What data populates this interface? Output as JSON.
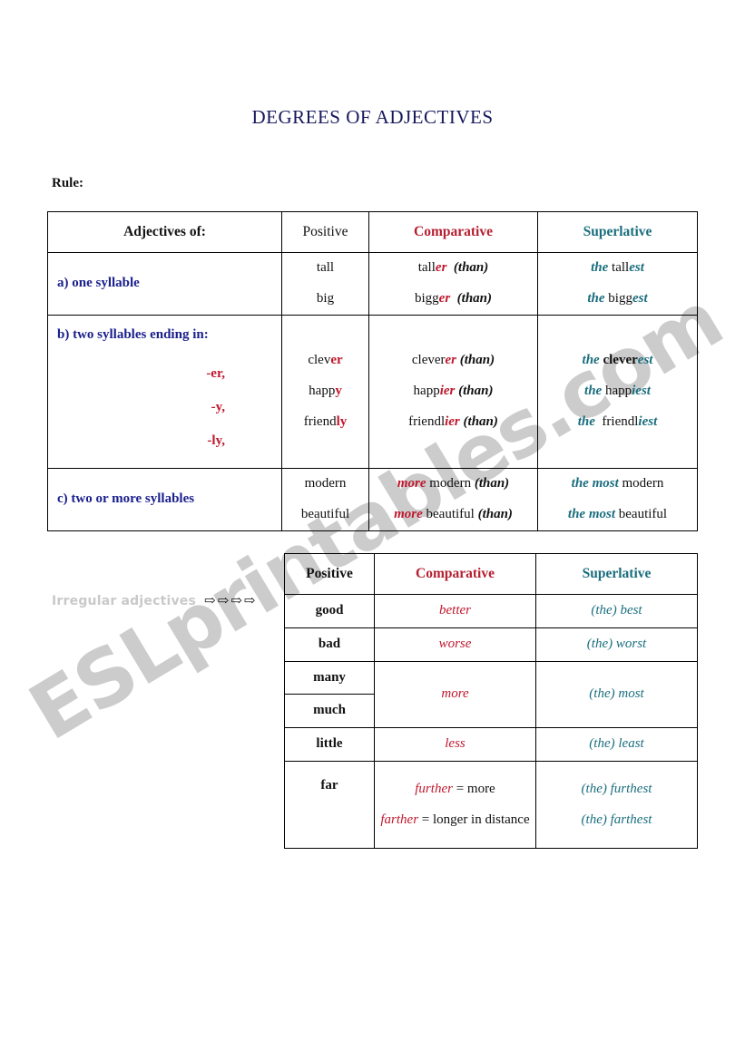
{
  "document": {
    "title": "DEGREES OF ADJECTIVES",
    "rule_label": "Rule:",
    "watermark": "ESLprintables.com"
  },
  "colors": {
    "title": "#16185c",
    "category": "#1a1f8c",
    "comparative": "#c0182e",
    "superlative": "#1a6e7e",
    "text": "#111111",
    "watermark": "#cccccc"
  },
  "rules_table": {
    "headers": {
      "category": "Adjectives of:",
      "positive": "Positive",
      "comparative": "Comparative",
      "superlative": "Superlative"
    },
    "rows": [
      {
        "category": "a) one syllable",
        "suffixes": [],
        "entries": [
          {
            "positive": "tall",
            "comparative": {
              "stem": "tall",
              "suffix": "er",
              "than": "(than)"
            },
            "superlative": {
              "the": "the",
              "stem": "tall",
              "suffix": "est"
            }
          },
          {
            "positive": "big",
            "comparative": {
              "stem": "bigg",
              "suffix": "er",
              "than": "(than)"
            },
            "superlative": {
              "the": "the",
              "stem": "bigg",
              "suffix": "est"
            }
          }
        ]
      },
      {
        "category": "b) two syllables ending in:",
        "suffixes": [
          "-er,",
          "-y,",
          "-ly,"
        ],
        "entries": [
          {
            "positive_stem": "clev",
            "positive_suffix": "er",
            "comparative": {
              "stem": "clever",
              "suffix": "er",
              "than": "(than)"
            },
            "superlative": {
              "the": "the",
              "stem": "clever",
              "suffix": "est"
            }
          },
          {
            "positive_stem": "happ",
            "positive_suffix": "y",
            "comparative": {
              "stem": "happ",
              "suffix": "ier",
              "than": "(than)"
            },
            "superlative": {
              "the": "the",
              "stem": "happ",
              "suffix": "iest"
            }
          },
          {
            "positive_stem": "friend",
            "positive_suffix": "ly",
            "comparative": {
              "stem": "friendl",
              "suffix": "ier",
              "than": "(than)"
            },
            "superlative": {
              "the": "the",
              "stem": "friendl",
              "suffix": "iest"
            }
          }
        ]
      },
      {
        "category": "c) two or more syllables",
        "suffixes": [],
        "entries": [
          {
            "positive": "modern",
            "comparative_more": "more",
            "comparative_word": "modern",
            "comparative_than": "(than)",
            "superlative_the_most": "the most",
            "superlative_word": "modern"
          },
          {
            "positive": "beautiful",
            "comparative_more": "more",
            "comparative_word": "beautiful",
            "comparative_than": "(than)",
            "superlative_the_most": "the most",
            "superlative_word": "beautiful"
          }
        ]
      }
    ]
  },
  "irregular_section": {
    "label": "Irregular adjectives",
    "arrow_icon": "⇨",
    "arrow_count": 4,
    "headers": {
      "positive": "Positive",
      "comparative": "Comparative",
      "superlative": "Superlative"
    },
    "rows": [
      {
        "positive": "good",
        "comparative": "better",
        "superlative": "(the) best"
      },
      {
        "positive": "bad",
        "comparative": "worse",
        "superlative": "(the) worst"
      },
      {
        "positive": "many",
        "comparative": "",
        "superlative": ""
      },
      {
        "positive": "much",
        "comparative": "more",
        "superlative": "(the) most"
      },
      {
        "positive": "little",
        "comparative": "less",
        "superlative": "(the) least"
      },
      {
        "positive": "far",
        "comparative_lines": [
          {
            "word": "further",
            "gloss": "= more"
          },
          {
            "word": "farther",
            "gloss": "= longer in distance"
          }
        ],
        "superlative_lines": [
          "(the) furthest",
          "(the) farthest"
        ]
      }
    ]
  }
}
